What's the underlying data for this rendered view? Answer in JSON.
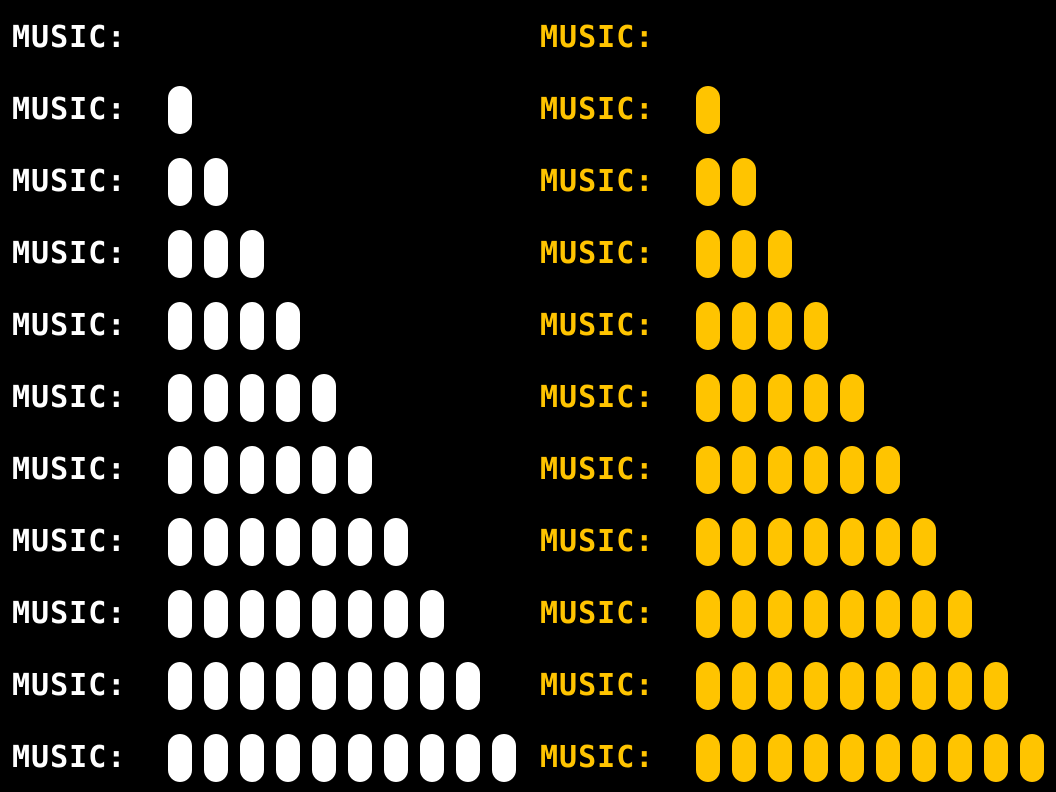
{
  "colors": {
    "background": "#000000",
    "white": "#ffffff",
    "gold": "#ffc400"
  },
  "columns": [
    {
      "id": "white",
      "color": "#ffffff",
      "rows": [
        {
          "label": "MUSIC:",
          "level": 0
        },
        {
          "label": "MUSIC:",
          "level": 1
        },
        {
          "label": "MUSIC:",
          "level": 2
        },
        {
          "label": "MUSIC:",
          "level": 3
        },
        {
          "label": "MUSIC:",
          "level": 4
        },
        {
          "label": "MUSIC:",
          "level": 5
        },
        {
          "label": "MUSIC:",
          "level": 6
        },
        {
          "label": "MUSIC:",
          "level": 7
        },
        {
          "label": "MUSIC:",
          "level": 8
        },
        {
          "label": "MUSIC:",
          "level": 9
        },
        {
          "label": "MUSIC:",
          "level": 10
        }
      ]
    },
    {
      "id": "gold",
      "color": "#ffc400",
      "rows": [
        {
          "label": "MUSIC:",
          "level": 0
        },
        {
          "label": "MUSIC:",
          "level": 1
        },
        {
          "label": "MUSIC:",
          "level": 2
        },
        {
          "label": "MUSIC:",
          "level": 3
        },
        {
          "label": "MUSIC:",
          "level": 4
        },
        {
          "label": "MUSIC:",
          "level": 5
        },
        {
          "label": "MUSIC:",
          "level": 6
        },
        {
          "label": "MUSIC:",
          "level": 7
        },
        {
          "label": "MUSIC:",
          "level": 8
        },
        {
          "label": "MUSIC:",
          "level": 9
        },
        {
          "label": "MUSIC:",
          "level": 10
        }
      ]
    }
  ]
}
